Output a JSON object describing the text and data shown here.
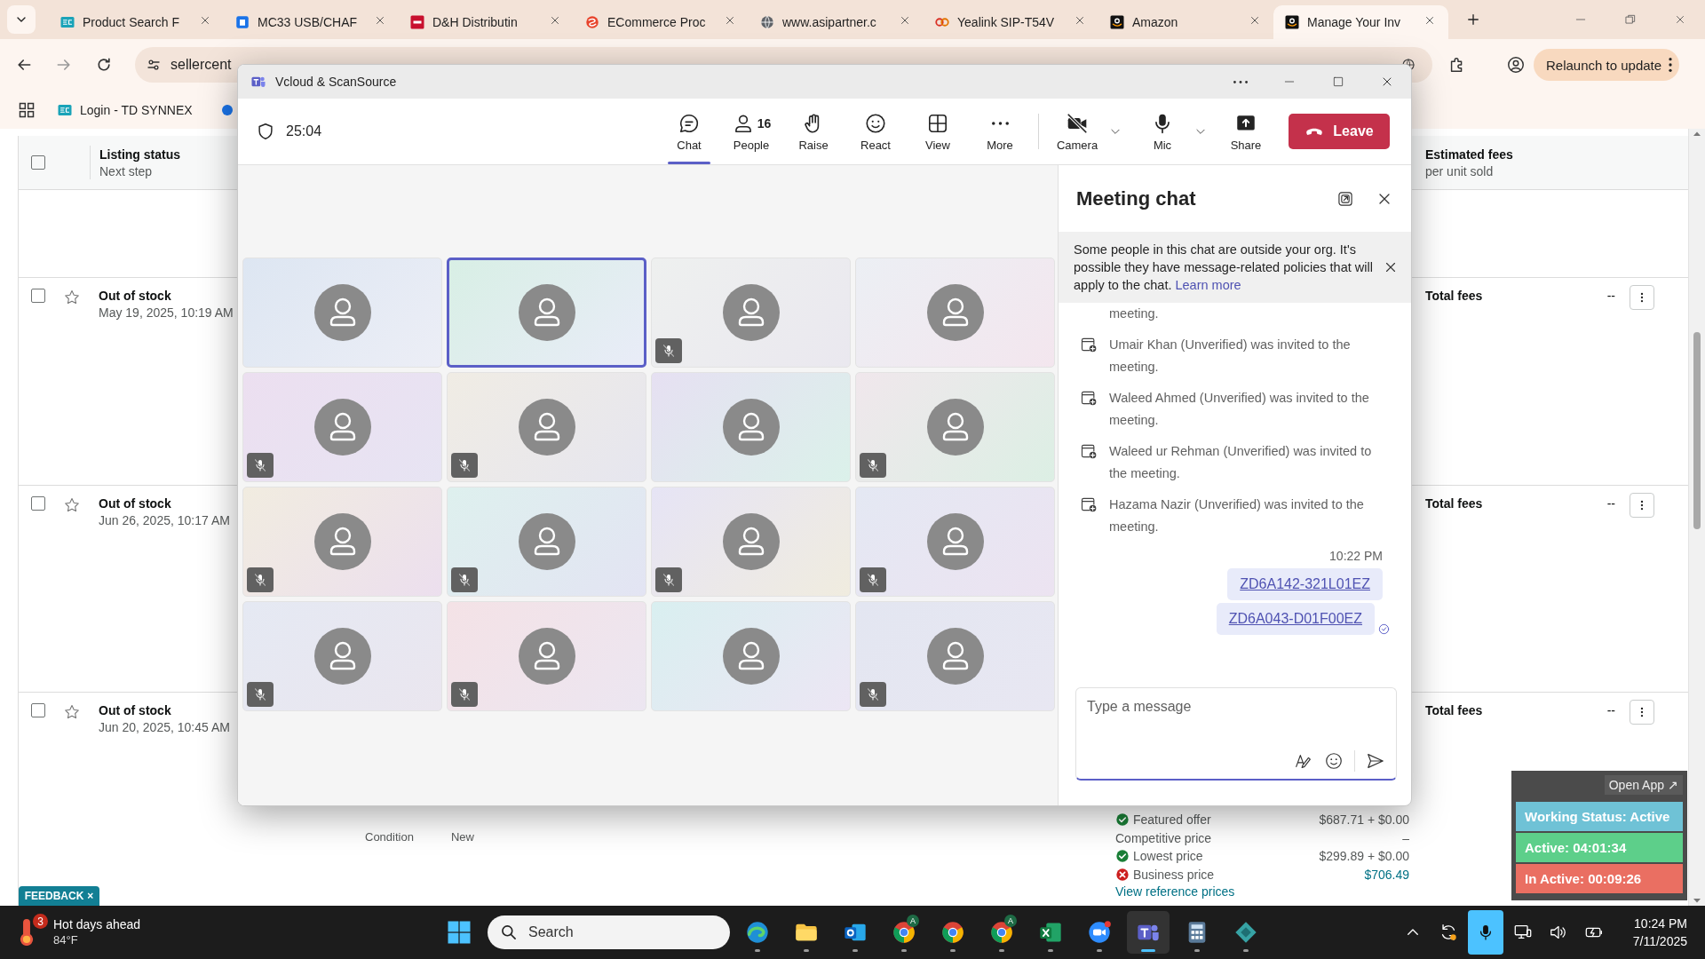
{
  "browser": {
    "tabs": [
      {
        "title": "Product Search F",
        "kind": "ec",
        "selected": false
      },
      {
        "title": "MC33 USB/CHAF",
        "kind": "doc",
        "selected": false
      },
      {
        "title": "D&H Distributin",
        "kind": "dh",
        "selected": false
      },
      {
        "title": "ECommerce Proc",
        "kind": "swirl",
        "selected": false
      },
      {
        "title": "www.asipartner.c",
        "kind": "globe",
        "selected": false
      },
      {
        "title": "Yealink SIP-T54V",
        "kind": "rings",
        "selected": false
      },
      {
        "title": "Amazon",
        "kind": "amazon",
        "selected": false
      },
      {
        "title": "Manage Your Inv",
        "kind": "amazon",
        "selected": true
      }
    ],
    "address": "sellercent",
    "relaunch": "Relaunch to update",
    "bookmarks": [
      {
        "label": "Login - TD SYNNEX",
        "kind": "ec"
      },
      {
        "kind": "dot"
      }
    ]
  },
  "page": {
    "header": {
      "checked": false,
      "status": "Listing status",
      "next": "Next step",
      "fees": "Estimated fees",
      "fees_sub": "per unit sold"
    },
    "rows": [
      {
        "checked": false,
        "starred": false,
        "status": "Out of stock",
        "date": "May 19, 2025, 10:19 AM",
        "fees": "Total fees",
        "amount": "--"
      },
      {
        "checked": false,
        "starred": false,
        "status": "Out of stock",
        "date": "Jun 26, 2025, 10:17 AM",
        "fees": "Total fees",
        "amount": "--"
      },
      {
        "checked": false,
        "starred": false,
        "status": "Out of stock",
        "date": "Jun 20, 2025, 10:45 AM",
        "fees": "Total fees",
        "amount": "--"
      }
    ],
    "condition": {
      "label": "Condition",
      "value": "New"
    },
    "offers": [
      {
        "kind": "ok",
        "label": "Featured offer",
        "price": "$687.71 + $0.00"
      },
      {
        "kind": "none",
        "label": "Competitive price",
        "price": "–"
      },
      {
        "kind": "ok",
        "label": "Lowest price",
        "price": "$299.89 + $0.00"
      },
      {
        "kind": "error",
        "label": "Business price",
        "price": "$706.49"
      }
    ],
    "reference_link": "View reference prices",
    "feedback": {
      "label": "FEEDBACK",
      "close": "×"
    }
  },
  "teams": {
    "title": "Vcloud & ScanSource",
    "timer": "25:04",
    "controls": [
      {
        "kind": "chat",
        "label": "Chat",
        "selected": true
      },
      {
        "kind": "people",
        "label": "People",
        "count": "16",
        "selected": false
      },
      {
        "kind": "raise",
        "label": "Raise",
        "selected": false
      },
      {
        "kind": "react",
        "label": "React",
        "selected": false
      },
      {
        "kind": "view",
        "label": "View",
        "selected": false
      },
      {
        "kind": "more",
        "label": "More",
        "selected": false
      },
      {
        "kind": "camera",
        "label": "Camera",
        "selected": false,
        "off": true
      },
      {
        "kind": "mic",
        "label": "Mic",
        "selected": false,
        "off": false
      },
      {
        "kind": "share",
        "label": "Share",
        "selected": false
      }
    ],
    "leave": "Leave",
    "tiles": [
      {
        "muted": false,
        "speaking": false
      },
      {
        "muted": false,
        "speaking": true
      },
      {
        "muted": true,
        "speaking": false
      },
      {
        "muted": false,
        "speaking": false
      },
      {
        "muted": true,
        "speaking": false
      },
      {
        "muted": true,
        "speaking": false
      },
      {
        "muted": false,
        "speaking": false
      },
      {
        "muted": true,
        "speaking": false
      },
      {
        "muted": true,
        "speaking": false
      },
      {
        "muted": true,
        "speaking": false
      },
      {
        "muted": true,
        "speaking": false
      },
      {
        "muted": true,
        "speaking": false
      },
      {
        "muted": true,
        "speaking": false
      },
      {
        "muted": true,
        "speaking": false
      },
      {
        "muted": false,
        "speaking": false
      },
      {
        "muted": true,
        "speaking": false
      }
    ],
    "chat": {
      "title": "Meeting chat",
      "notice": "Some people in this chat are outside your org. It's possible they have message-related policies that will apply to the chat.",
      "notice_link": "Learn more",
      "events": [
        {
          "kind": "continuation",
          "text": "meeting."
        },
        {
          "kind": "invite",
          "text": "Umair Khan (Unverified) was invited to the meeting."
        },
        {
          "kind": "invite",
          "text": "Waleed Ahmed (Unverified) was invited to the meeting."
        },
        {
          "kind": "invite",
          "text": "Waleed ur Rehman (Unverified) was invited to the meeting."
        },
        {
          "kind": "invite",
          "text": "Hazama Nazir (Unverified) was invited to the meeting."
        }
      ],
      "time": "10:22 PM",
      "messages": [
        "ZD6A142-321L01EZ",
        "ZD6A043-D01F00EZ"
      ],
      "placeholder": "Type a message"
    }
  },
  "tracker": {
    "open_label": "Open App",
    "open_icon": "↗",
    "statuses": [
      {
        "text": "Working Status: Active",
        "color": "#6fc2d6"
      },
      {
        "text": "Active: 04:01:34",
        "color": "#5dcf8a"
      },
      {
        "text": "In Active: 00:09:26",
        "color": "#ea6f62"
      }
    ]
  },
  "taskbar": {
    "weather": {
      "badge": "3",
      "title": "Hot days ahead",
      "temp": "84°F"
    },
    "search": "Search",
    "apps": [
      {
        "kind": "edge",
        "active": false
      },
      {
        "kind": "files",
        "active": false
      },
      {
        "kind": "outlook",
        "active": false
      },
      {
        "kind": "chrome",
        "active": false,
        "badge": "A"
      },
      {
        "kind": "chrome",
        "active": false
      },
      {
        "kind": "chrome",
        "active": false,
        "badge": "A"
      },
      {
        "kind": "excel",
        "active": false
      },
      {
        "kind": "zoom",
        "active": false
      },
      {
        "kind": "teams",
        "active": true
      },
      {
        "kind": "calculator",
        "active": false
      },
      {
        "kind": "diamond",
        "active": false
      }
    ],
    "time": "10:24 PM",
    "date": "7/11/2025"
  }
}
